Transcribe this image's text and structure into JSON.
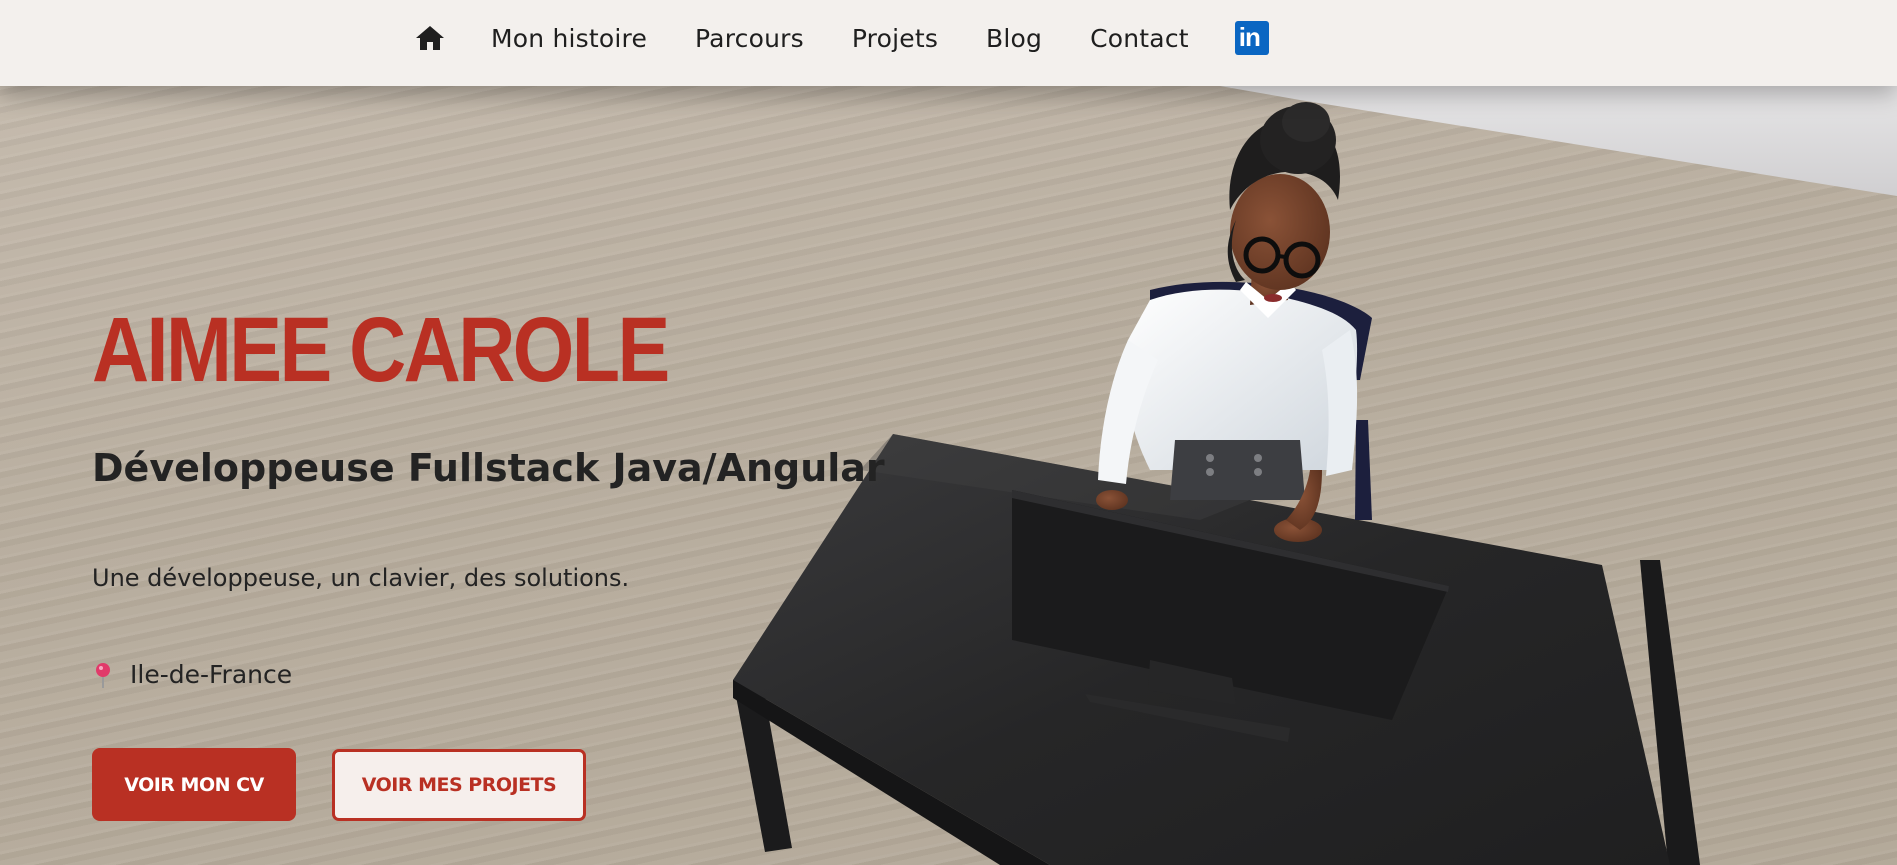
{
  "nav": {
    "home_icon": "home-icon",
    "links": [
      "Mon histoire",
      "Parcours",
      "Projets",
      "Blog",
      "Contact"
    ],
    "linkedin_icon": "linkedin-icon",
    "linkedin_text": "in"
  },
  "hero": {
    "name": "AIMEE CAROLE",
    "role": "Développeuse Fullstack Java/Angular",
    "tagline": "Une développeuse, un clavier, des solutions.",
    "location_icon": "map-pin-icon",
    "location": "Ile-de-France",
    "cv_button": "VOIR MON CV",
    "projects_button": "VOIR MES PROJETS"
  },
  "colors": {
    "accent": "#b93023",
    "nav_bg": "#f3f0ed",
    "linkedin_blue": "#0a66c2",
    "text_dark": "#232323"
  }
}
